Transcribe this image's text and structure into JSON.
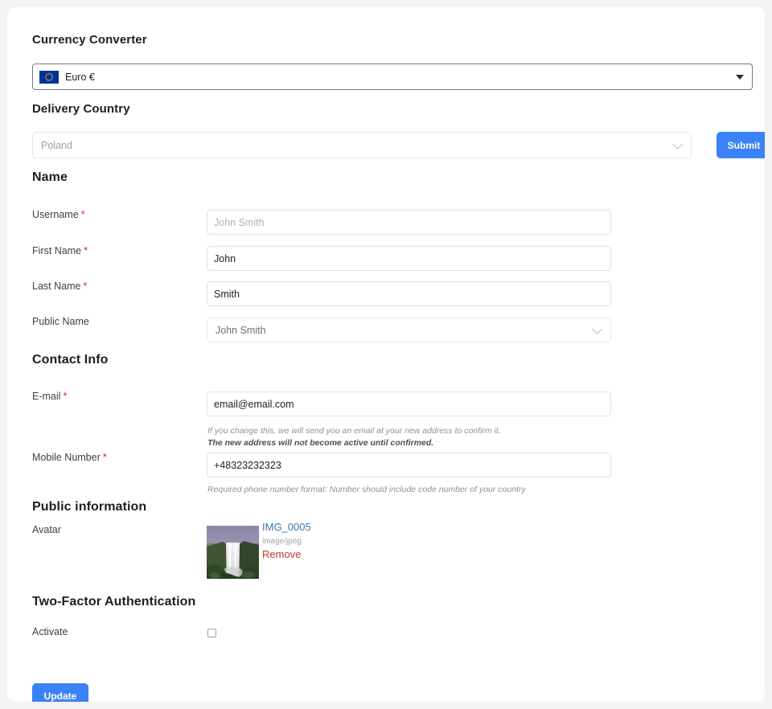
{
  "currency": {
    "heading": "Currency Converter",
    "selected": "Euro €",
    "flag_icon": "eu-flag-icon"
  },
  "delivery": {
    "heading": "Delivery Country",
    "selected": "Poland",
    "submit_label": "Submit"
  },
  "name_section": {
    "heading": "Name",
    "fields": [
      {
        "label": "Username",
        "required": "*",
        "value": "John Smith",
        "is_placeholder": true
      },
      {
        "label": "First Name",
        "required": "*",
        "value": "John",
        "is_placeholder": false
      },
      {
        "label": "Last Name",
        "required": "*",
        "value": "Smith",
        "is_placeholder": false
      }
    ],
    "public_name": {
      "label": "Public Name",
      "value": "John Smith"
    }
  },
  "contact": {
    "heading": "Contact Info",
    "email": {
      "label": "E-mail",
      "required": "*",
      "value": "email@email.com",
      "hint_line1": "If you change this, we will send you an email at your new address to confirm it.",
      "hint_line2": "The new address will not become active until confirmed."
    },
    "mobile": {
      "label": "Mobile Number",
      "required": "*",
      "value": "+48323232323",
      "hint": "Required phone number format: Number should include code number of your country"
    }
  },
  "public_information": {
    "heading": "Public information",
    "avatar": {
      "label": "Avatar",
      "file_name": "IMG_0005",
      "file_type": "image/jpeg",
      "remove_label": "Remove"
    }
  },
  "two_factor": {
    "heading": "Two-Factor Authentication",
    "activate_label": "Activate",
    "checked": false
  },
  "footer": {
    "update_label": "Update"
  },
  "colors": {
    "accent_blue": "#3b82f6",
    "required_red": "#e01b24",
    "link_blue": "#3c73a8",
    "remove_red": "#c0392b",
    "flag_blue": "#003399",
    "flag_star_yellow": "#ffcc00"
  }
}
